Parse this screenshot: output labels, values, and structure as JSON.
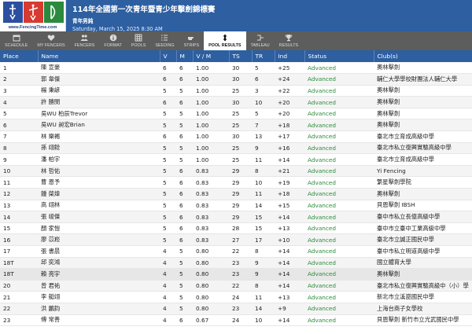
{
  "header": {
    "title": "114年全國第一次青年暨青少年擊劍錦標賽",
    "event": "青年男鈍",
    "date": "Saturday, March 15, 2025 8:30 AM",
    "logo_url": "www.FencingTime.com"
  },
  "colors": {
    "header_bg": "#2d5fa1",
    "nav_bg": "#5d5d5d",
    "status": "#2d8b3a"
  },
  "nav": {
    "tabs": [
      {
        "label": "Schedule",
        "icon": "calendar-icon",
        "name": "schedule"
      },
      {
        "label": "My Fencers",
        "icon": "heart-icon",
        "name": "my-fencers"
      },
      {
        "label": "Fencers",
        "icon": "people-icon",
        "name": "fencers"
      },
      {
        "label": "Format",
        "icon": "info-icon",
        "name": "format"
      },
      {
        "label": "Pools",
        "icon": "grid-icon",
        "name": "pools"
      },
      {
        "label": "Seeding",
        "icon": "list-icon",
        "name": "seeding"
      },
      {
        "label": "Strips",
        "icon": "pointing-hand-icon",
        "name": "strips"
      },
      {
        "label": "Pool Results",
        "icon": "sort-arrows-icon",
        "name": "pool-results",
        "active": true
      },
      {
        "label": "Tableau",
        "icon": "bracket-icon",
        "name": "tableau"
      },
      {
        "label": "Results",
        "icon": "trophy-icon",
        "name": "results"
      }
    ]
  },
  "table": {
    "columns": [
      "Place",
      "Name",
      "V",
      "M",
      "V / M",
      "TS",
      "TR",
      "Ind",
      "Status",
      "Club(s)"
    ],
    "rows": [
      [
        "1",
        "陳 宣豪",
        "6",
        "6",
        "1.00",
        "30",
        "5",
        "+25",
        "Advanced",
        "奧林擊劍"
      ],
      [
        "2",
        "郭 韋傑",
        "6",
        "6",
        "1.00",
        "30",
        "6",
        "+24",
        "Advanced",
        "輔仁大學學校財團法人輔仁大學"
      ],
      [
        "3",
        "楊 秉諺",
        "5",
        "5",
        "1.00",
        "25",
        "3",
        "+22",
        "Advanced",
        "奧林擊劍"
      ],
      [
        "4",
        "許 勝閔",
        "6",
        "6",
        "1.00",
        "30",
        "10",
        "+20",
        "Advanced",
        "奧林擊劍"
      ],
      [
        "5",
        "吳WU 柏辰Trevor",
        "5",
        "5",
        "1.00",
        "25",
        "5",
        "+20",
        "Advanced",
        "奧林擊劍"
      ],
      [
        "6",
        "吳WU 昶宏Brian",
        "5",
        "5",
        "1.00",
        "25",
        "7",
        "+18",
        "Advanced",
        "奧林擊劍"
      ],
      [
        "7",
        "林 樂裼",
        "6",
        "6",
        "1.00",
        "30",
        "13",
        "+17",
        "Advanced",
        "臺北市立育成高級中學"
      ],
      [
        "8",
        "孫 翊銓",
        "5",
        "5",
        "1.00",
        "25",
        "9",
        "+16",
        "Advanced",
        "臺北市私立復興實驗高級中學"
      ],
      [
        "9",
        "潘 柏宇",
        "5",
        "5",
        "1.00",
        "25",
        "11",
        "+14",
        "Advanced",
        "臺北市立育成高級中學"
      ],
      [
        "10",
        "林 哲佑",
        "5",
        "6",
        "0.83",
        "29",
        "8",
        "+21",
        "Advanced",
        "Yi Fencing"
      ],
      [
        "11",
        "曹 恩予",
        "5",
        "6",
        "0.83",
        "29",
        "10",
        "+19",
        "Advanced",
        "繁星擊劍學院"
      ],
      [
        "12",
        "鍾 棨煒",
        "5",
        "6",
        "0.83",
        "29",
        "11",
        "+18",
        "Advanced",
        "奧林擊劍"
      ],
      [
        "13",
        "高 翊林",
        "5",
        "6",
        "0.83",
        "29",
        "14",
        "+15",
        "Advanced",
        "貝恩擊劍 IBSH"
      ],
      [
        "14",
        "張 竣傑",
        "5",
        "6",
        "0.83",
        "29",
        "15",
        "+14",
        "Advanced",
        "臺中市私立長億高級中學"
      ],
      [
        "15",
        "顏 家愷",
        "5",
        "6",
        "0.83",
        "28",
        "15",
        "+13",
        "Advanced",
        "臺中市立臺中工業高級中學"
      ],
      [
        "16",
        "廖 苡崧",
        "5",
        "6",
        "0.83",
        "27",
        "17",
        "+10",
        "Advanced",
        "臺北市立誠正國民中學"
      ],
      [
        "17",
        "張 書晨",
        "4",
        "5",
        "0.80",
        "22",
        "8",
        "+14",
        "Advanced",
        "臺中市私立明道高級中學"
      ],
      [
        "18T",
        "邱 奕鴻",
        "4",
        "5",
        "0.80",
        "23",
        "9",
        "+14",
        "Advanced",
        "國立體育大學"
      ],
      [
        "18T",
        "賴 亮宇",
        "4",
        "5",
        "0.80",
        "23",
        "9",
        "+14",
        "Advanced",
        "奧林擊劍"
      ],
      [
        "20",
        "曾 君祐",
        "4",
        "5",
        "0.80",
        "22",
        "8",
        "+14",
        "Advanced",
        "臺北市私立復興實驗高級中（小）學"
      ],
      [
        "21",
        "李 艇翊",
        "4",
        "5",
        "0.80",
        "24",
        "11",
        "+13",
        "Advanced",
        "新北市立溪崑國民中學"
      ],
      [
        "22",
        "洪 鵬鈞",
        "4",
        "5",
        "0.80",
        "23",
        "14",
        "+9",
        "Advanced",
        "上海台商子女學校"
      ],
      [
        "23",
        "傅 常善",
        "4",
        "6",
        "0.67",
        "24",
        "10",
        "+14",
        "Advanced",
        "貝恩擊劍 新竹市立光武國民中學"
      ]
    ],
    "highlight_row": 18
  }
}
